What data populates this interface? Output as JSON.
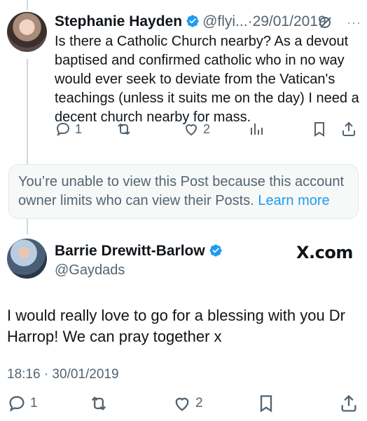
{
  "post1": {
    "author_name": "Stephanie Hayden",
    "handle": "@flyi...",
    "separator": "·",
    "date": "29/01/2019",
    "text": "Is there a Catholic Church nearby? As a devout\nbaptised and confirmed catholic who in no way\nwould ever seek to deviate from the Vatican's\nteachings (unless it suits me on the day) I need a\ndecent church nearby for mass.",
    "more_icon": "ellipsis-icon",
    "actions": {
      "replies": "1",
      "likes": "2"
    }
  },
  "notice": {
    "text": "You’re unable to view this Post because this account owner limits who can view their Posts.",
    "link_label": "Learn more"
  },
  "post2": {
    "author_name": "Barrie Drewitt-Barlow",
    "handle": "@Gaydads",
    "watermark": "X.com",
    "text": "I would really love to go for a blessing with you Dr\nHarrop! We can pray together x",
    "timestamp": "18:16 · 30/01/2019",
    "actions": {
      "replies": "1",
      "likes": "2"
    }
  },
  "colors": {
    "verified_blue": "#1d9bf0",
    "muted_text": "#536471",
    "link": "#1d9bf0",
    "notice_bg": "#f7f9f9"
  }
}
